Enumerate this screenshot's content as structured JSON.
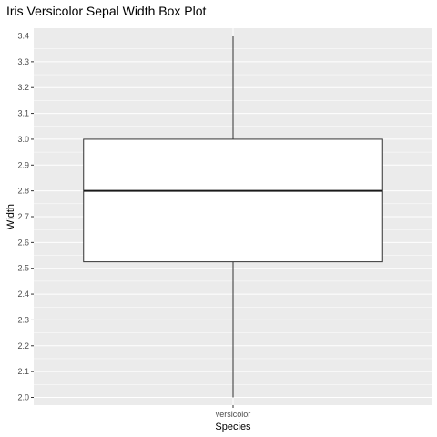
{
  "chart_data": {
    "type": "boxplot",
    "title": "Iris Versicolor Sepal Width Box Plot",
    "xlabel": "Species",
    "ylabel": "Width",
    "categories": [
      "versicolor"
    ],
    "boxes": [
      {
        "category": "versicolor",
        "min": 2.0,
        "q1": 2.525,
        "median": 2.8,
        "q3": 3.0,
        "max": 3.4
      }
    ],
    "ylim": [
      1.97,
      3.43
    ],
    "yticks": [
      2.0,
      2.1,
      2.2,
      2.3,
      2.4,
      2.5,
      2.6,
      2.7,
      2.8,
      2.9,
      3.0,
      3.1,
      3.2,
      3.3,
      3.4
    ],
    "ytick_labels": [
      "2.0",
      "2.1",
      "2.2",
      "2.3",
      "2.4",
      "2.5",
      "2.6",
      "2.7",
      "2.8",
      "2.9",
      "3.0",
      "3.1",
      "3.2",
      "3.3",
      "3.4"
    ],
    "grid": true,
    "colors": {
      "panel": "#ebebeb",
      "grid": "#ffffff",
      "box_fill": "#ffffff",
      "box_line": "#333333",
      "median": "#1a1a1a"
    }
  }
}
